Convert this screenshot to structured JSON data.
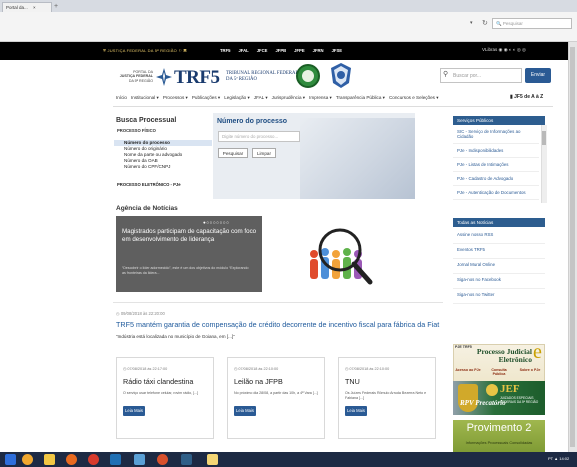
{
  "browser": {
    "tab_label": "Portal da...",
    "tab_close": "×",
    "new_tab": "+",
    "search_placeholder": "Pesquisar"
  },
  "gov_bar": {
    "justice_text": "JUSTIÇA FEDERAL DA 5ª REGIÃO",
    "menu": [
      "TRF5",
      "JFAL",
      "JFCE",
      "JFPB",
      "JFPE",
      "JFRN",
      "JFSE"
    ],
    "vlibras": "VLibras"
  },
  "header": {
    "portal_line1": "PORTAL DA",
    "portal_line2": "JUSTIÇA FEDERAL",
    "portal_line3": "DA 5ª REGIÃO",
    "trf5": "TRF5",
    "trf_line1": "TRIBUNAL REGIONAL FEDERAL",
    "trf_line2": "DA 5ª REGIÃO",
    "search_placeholder": "Buscar por...",
    "search_button": "Enviar"
  },
  "nav": {
    "items": [
      "Início",
      "Institucional ▾",
      "Processos ▾",
      "Publicações ▾",
      "Legislação ▾",
      "JFAL ▾",
      "Jurisprudência ▾",
      "Imprensa ▾",
      "Transparência Pública ▾",
      "Concursos e Seleções ▾"
    ],
    "az": "JF5 de A à Z"
  },
  "busca": {
    "title": "Busca Processual",
    "fisico": "PROCESSO FÍSICO",
    "items": [
      "Número do processo",
      "Número do originário",
      "Nome da parte ou advogado",
      "Número da OAB",
      "Número do CPF/CNPJ"
    ],
    "eletronico": "PROCESSO ELETRÔNICO - PJe"
  },
  "numero_processo": {
    "title": "Número do processo",
    "placeholder": "Digite número do processo...",
    "pesquisar": "Pesquisar",
    "limpar": "Limpar"
  },
  "servicos": {
    "title": "Serviços Públicos",
    "items": [
      "SIC - Serviço de Informações ao Cidadão",
      "PJe - Indisponibilidades",
      "PJe - Listas de Intimações",
      "PJe - Cadastro de Advogado",
      "PJe - Autenticação de Documentos"
    ]
  },
  "noticias_links": {
    "title": "Todas as Notícias",
    "items": [
      "Assine nosso RSS",
      "Eventos TRF5",
      "Jornal Mural Online",
      "Siga-nos no Facebook",
      "Siga-nos no Twitter"
    ]
  },
  "agencia": {
    "title": "Agência de Notícias",
    "dots": "●○○○○○○○",
    "slide_title": "Magistrados participam de capacitação com foco em desenvolvimento de liderança",
    "slide_text": "“Descobrir o líder adormecido”, este é um dos objetivos do módulo “Explorando as fronteiras da lidera..."
  },
  "headline": {
    "date": "09/08/2018 às 22:20:00",
    "title": "TRF5 mantém garantia de compensação de crédito decorrente de incentivo fiscal para fábrica da Fiat",
    "sub": "“Indústria está localizada no município de Goiana, em [...]”"
  },
  "cards": [
    {
      "date": "07/08/2018 às 22:17:00",
      "title": "Rádio táxi clandestina",
      "text": "O serviço usar telefone celular, rovim rádio, [...]",
      "button": "Leia Mais"
    },
    {
      "date": "07/08/2018 às 22:10:00",
      "title": "Leilão na JFPB",
      "text": "No próximo dia 28/08, a partir das 10h, a 4ª Vara [...]",
      "button": "Leia Mais"
    },
    {
      "date": "07/08/2018 às 22:10:00",
      "title": "TNU",
      "text": "Os Juízes Federais Rômulo Arruda Bezerra Neto e Fabiana [...]",
      "button": "Leia Mais"
    }
  ],
  "banners": {
    "pje_label": "PJE TRF5",
    "pje_title": "Processo Judicial Eletrônico",
    "pje_e": "e",
    "pje_links": [
      "Acesso ao PJe",
      "Consulta Pública",
      "Sobre o PJe"
    ],
    "rpv": "RPV Precatório",
    "jef": "JEF",
    "jef_sub": "JUIZADOS ESPECIAIS FEDERAIS DA 5ª REGIÃO",
    "prov_title": "Provimento 2",
    "prov_sub": "Informações Processuais Consolidadas"
  },
  "taskbar": {
    "time": "PT ▲ 14:02"
  },
  "colors": {
    "brand_blue": "#1a3b6e",
    "link_blue": "#2a5a94",
    "gov_bar": "#000000",
    "sidebar_header": "#2d5d8f"
  }
}
